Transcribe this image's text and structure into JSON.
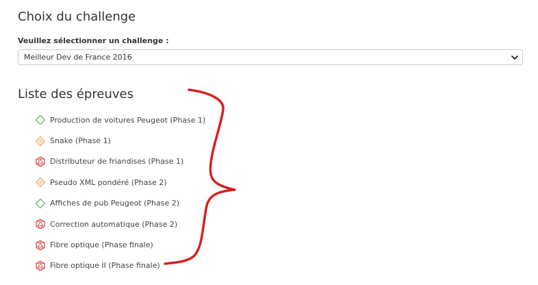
{
  "header": {
    "title": "Choix du challenge"
  },
  "challenge_select": {
    "label": "Veuillez sélectionner un challenge :",
    "value": "Meilleur Dev de France 2016"
  },
  "events": {
    "title": "Liste des épreuves",
    "items": [
      {
        "label": "Production de voitures Peugeot (Phase 1)",
        "icon": "diamond-icon",
        "color": "#6dba6d"
      },
      {
        "label": "Snake (Phase 1)",
        "icon": "orange-gem-icon",
        "color": "#f0b46a"
      },
      {
        "label": "Distributeur de friandises (Phase 1)",
        "icon": "red-polyhedron-icon",
        "color": "#e04a4a"
      },
      {
        "label": "Pseudo XML pondéré (Phase 2)",
        "icon": "orange-gem-icon",
        "color": "#f0b46a"
      },
      {
        "label": "Affiches de pub Peugeot (Phase 2)",
        "icon": "diamond-icon",
        "color": "#6dba6d"
      },
      {
        "label": "Correction automatique (Phase 2)",
        "icon": "red-polyhedron-icon",
        "color": "#e04a4a"
      },
      {
        "label": "Fibre optique (Phase finale)",
        "icon": "red-polyhedron-icon",
        "color": "#e04a4a"
      },
      {
        "label": "Fibre optique II (Phase finale)",
        "icon": "red-polyhedron-icon",
        "color": "#e04a4a"
      }
    ]
  },
  "annotation": {
    "color": "#d62020"
  }
}
